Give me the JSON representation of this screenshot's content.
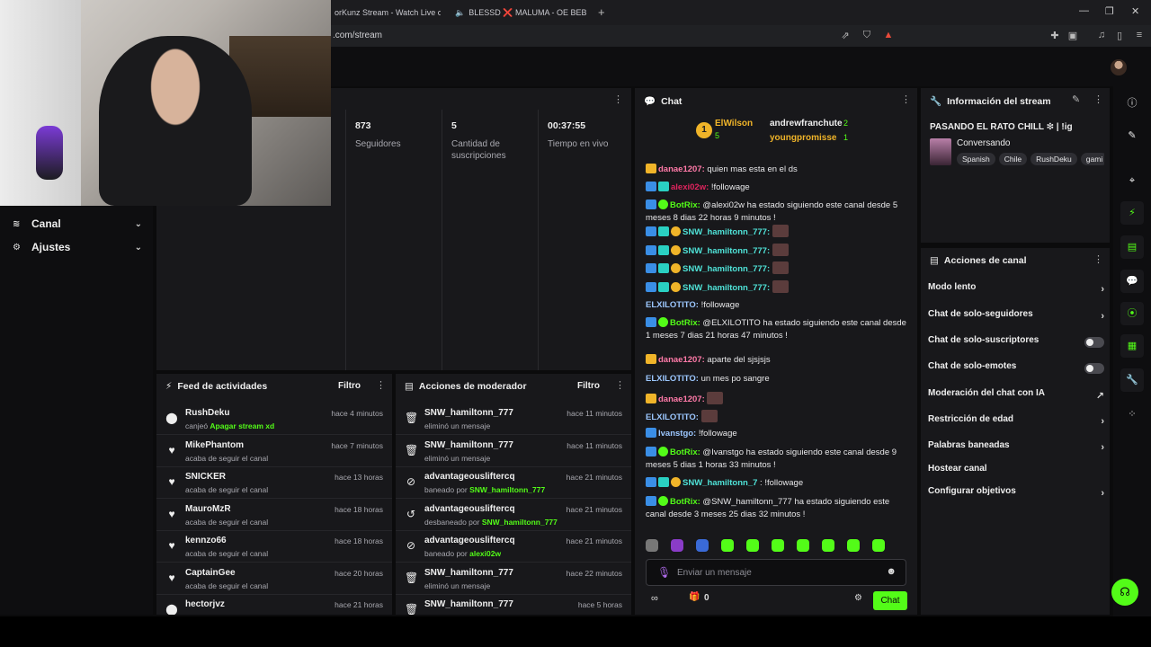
{
  "browser": {
    "tabs": [
      {
        "label": "orKunz Stream - Watch Live on K"
      },
      {
        "label": "BLESSD ❌ MALUMA - OE BEBÉ"
      }
    ],
    "url": ".com/stream"
  },
  "leftnav": [
    {
      "label": "Canal",
      "icon": "≋"
    },
    {
      "label": "Ajustes",
      "icon": "⚙"
    }
  ],
  "stats": [
    {
      "value": "873",
      "label": "Seguidores"
    },
    {
      "value": "5",
      "label": "Cantidad de suscripciones"
    },
    {
      "value": "00:37:55",
      "label": "Tiempo en vivo"
    }
  ],
  "feed": {
    "title": "Feed de actividades",
    "filter": "Filtro",
    "rows": [
      {
        "name": "RushDeku",
        "sub": "canjeó ",
        "hl": "Apagar stream xd",
        "time": "hace 4 minutos",
        "icon": "⬤"
      },
      {
        "name": "MikePhantom",
        "sub": "acaba de seguir el canal",
        "hl": "",
        "time": "hace 7 minutos",
        "icon": "♥"
      },
      {
        "name": "SNICKER",
        "sub": "acaba de seguir el canal",
        "hl": "",
        "time": "hace 13 horas",
        "icon": "♥"
      },
      {
        "name": "MauroMzR",
        "sub": "acaba de seguir el canal",
        "hl": "",
        "time": "hace 18 horas",
        "icon": "♥"
      },
      {
        "name": "kennzo66",
        "sub": "acaba de seguir el canal",
        "hl": "",
        "time": "hace 18 horas",
        "icon": "♥"
      },
      {
        "name": "CaptainGee",
        "sub": "acaba de seguir el canal",
        "hl": "",
        "time": "hace 20 horas",
        "icon": "♥"
      },
      {
        "name": "hectorjvz",
        "sub": "",
        "hl": "",
        "time": "hace 21 horas",
        "icon": "⬤"
      }
    ]
  },
  "mod": {
    "title": "Acciones de moderador",
    "filter": "Filtro",
    "rows": [
      {
        "name": "SNW_hamiltonn_777",
        "sub": "eliminó un mensaje",
        "hl": "",
        "time": "hace 11 minutos",
        "icon": "🗑"
      },
      {
        "name": "SNW_hamiltonn_777",
        "sub": "eliminó un mensaje",
        "hl": "",
        "time": "hace 11 minutos",
        "icon": "🗑"
      },
      {
        "name": "advantageousliftercq",
        "sub": "baneado por ",
        "hl": "SNW_hamiltonn_777",
        "time": "hace 21 minutos",
        "icon": "⊘"
      },
      {
        "name": "advantageousliftercq",
        "sub": "desbaneado por ",
        "hl": "SNW_hamiltonn_777",
        "time": "hace 21 minutos",
        "icon": "↺"
      },
      {
        "name": "advantageousliftercq",
        "sub": "baneado por ",
        "hl": "alexi02w",
        "time": "hace 21 minutos",
        "icon": "⊘"
      },
      {
        "name": "SNW_hamiltonn_777",
        "sub": "eliminó un mensaje",
        "hl": "",
        "time": "hace 22 minutos",
        "icon": "🗑"
      },
      {
        "name": "SNW_hamiltonn_777",
        "sub": "",
        "hl": "",
        "time": "hace 5 horas",
        "icon": "🗑"
      }
    ]
  },
  "chat": {
    "title": "Chat",
    "podium": {
      "first": {
        "name": "ElWilson",
        "count": "5"
      },
      "second": {
        "name": "andrewfranchute",
        "count": "2"
      },
      "third": {
        "name": "youngpromisse",
        "count": "1"
      }
    },
    "placeholder": "Enviar un mensaje",
    "points": "0",
    "send": "Chat",
    "lines": [
      {
        "user": "danae1207:",
        "cls": "u-pink",
        "badges": [
          "b-crown"
        ],
        "text": " quien mas esta en el ds"
      },
      {
        "user": "alexi02w:",
        "cls": "u-red",
        "badges": [
          "b-blue",
          "b-teal"
        ],
        "text": " !followage"
      },
      {
        "user": "BotRix:",
        "cls": "u-green",
        "badges": [
          "b-blue",
          "b-green"
        ],
        "text": " @alexi02w ha estado siguiendo este canal desde 5 meses 8 dias 22 horas 9 minutos !"
      },
      {
        "user": "SNW_hamiltonn_777:",
        "cls": "u-teal",
        "badges": [
          "b-blue",
          "b-teal",
          "b-gold"
        ],
        "text": " ",
        "emote": true
      },
      {
        "user": "SNW_hamiltonn_777:",
        "cls": "u-teal",
        "badges": [
          "b-blue",
          "b-teal",
          "b-gold"
        ],
        "text": " ",
        "emote": true
      },
      {
        "user": "SNW_hamiltonn_777:",
        "cls": "u-teal",
        "badges": [
          "b-blue",
          "b-teal",
          "b-gold"
        ],
        "text": " ",
        "emote": true
      },
      {
        "user": "SNW_hamiltonn_777:",
        "cls": "u-teal",
        "badges": [
          "b-blue",
          "b-teal",
          "b-gold"
        ],
        "text": " ",
        "emote": true
      },
      {
        "user": "ELXILOTITO:",
        "cls": "u-lblue",
        "badges": [],
        "text": " !followage"
      },
      {
        "user": "BotRix:",
        "cls": "u-green",
        "badges": [
          "b-blue",
          "b-green"
        ],
        "text": " @ELXILOTITO ha estado siguiendo este canal desde 1 meses 7 dias 21 horas 47 minutos !"
      },
      {
        "user": "danae1207:",
        "cls": "u-pink",
        "badges": [
          "b-crown"
        ],
        "text": " aparte del sjsjsjs"
      },
      {
        "user": "ELXILOTITO:",
        "cls": "u-lblue",
        "badges": [],
        "text": " un mes po sangre"
      },
      {
        "user": "danae1207:",
        "cls": "u-pink",
        "badges": [
          "b-crown"
        ],
        "text": " ",
        "emote": true
      },
      {
        "user": "ELXILOTITO:",
        "cls": "u-lblue",
        "badges": [],
        "text": " ",
        "emote": true
      },
      {
        "user": "Ivanstgo:",
        "cls": "u-lblue",
        "badges": [
          "b-blue"
        ],
        "text": " !followage"
      },
      {
        "user": "BotRix:",
        "cls": "u-green",
        "badges": [
          "b-blue",
          "b-green"
        ],
        "text": " @Ivanstgo ha estado siguiendo este canal desde 9 meses 5 dias 1 horas 33 minutos !"
      },
      {
        "user": "SNW_hamiltonn_7",
        "cls": "u-teal",
        "badges": [
          "b-blue",
          "b-teal",
          "b-gold"
        ],
        "text": " : !followage"
      },
      {
        "user": "BotRix:",
        "cls": "u-green",
        "badges": [
          "b-blue",
          "b-green"
        ],
        "text": " @SNW_hamiltonn_777 ha estado siguiendo este canal desde 3 meses 25 dias 32 minutos !"
      }
    ]
  },
  "streaminfo": {
    "title": "Información del stream",
    "stream_title": "PASANDO EL RATO CHILL ❇ | !ig",
    "category": "Conversando",
    "tags": [
      "Spanish",
      "Chile",
      "RushDeku",
      "gami"
    ]
  },
  "actions": {
    "title": "Acciones de canal",
    "items": [
      {
        "label": "Modo lento",
        "ctrl": "chev"
      },
      {
        "label": "Chat de solo-seguidores",
        "ctrl": "chev"
      },
      {
        "label": "Chat de solo-suscriptores",
        "ctrl": "toggle"
      },
      {
        "label": "Chat de solo-emotes",
        "ctrl": "toggle"
      },
      {
        "label": "Moderación del chat con IA",
        "ctrl": "ext"
      },
      {
        "label": "Restricción de edad",
        "ctrl": "chev"
      },
      {
        "label": "Palabras baneadas",
        "ctrl": "chev"
      },
      {
        "label": "Hostear canal",
        "ctrl": "none"
      },
      {
        "label": "Configurar objetivos",
        "ctrl": "chev"
      }
    ]
  },
  "colors": {
    "accent": "#53fc18",
    "panel": "#18181b",
    "background": "#0b0b0c"
  }
}
